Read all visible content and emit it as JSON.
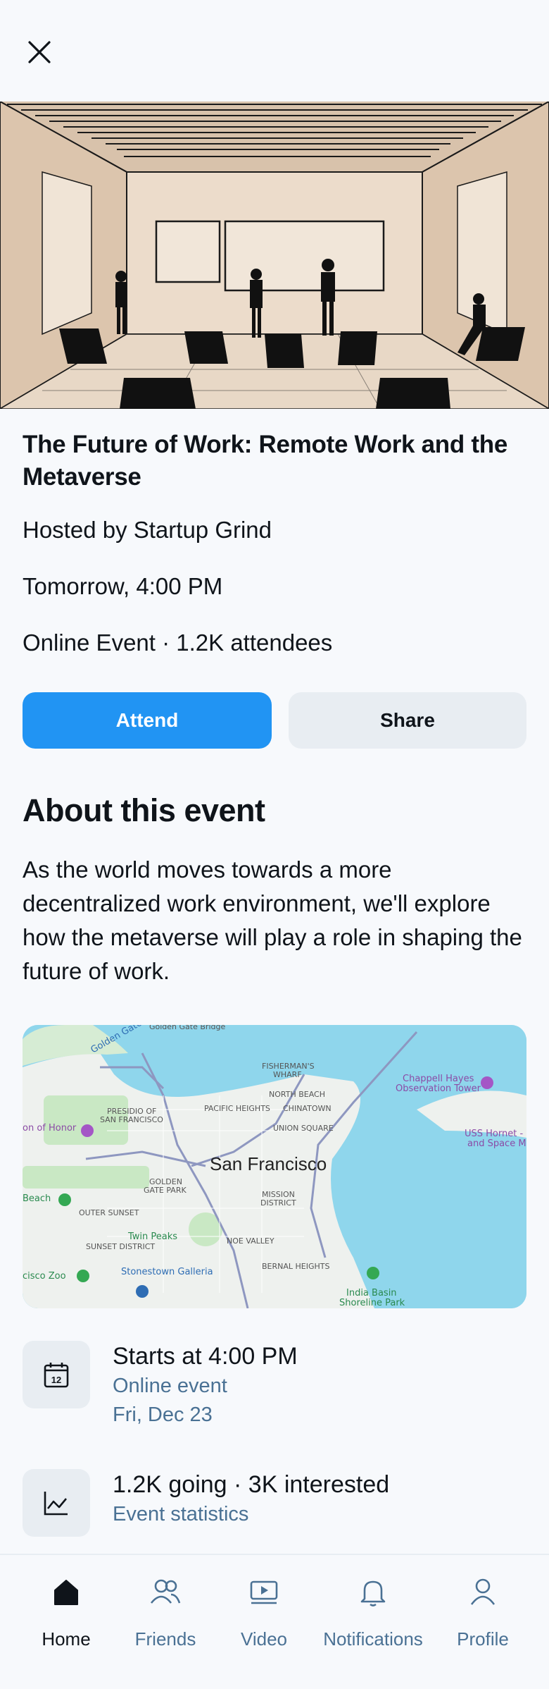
{
  "event": {
    "title": "The Future of Work: Remote Work and the Metaverse",
    "host": "Hosted by Startup Grind",
    "datetime": "Tomorrow, 4:00 PM",
    "location_attendance": "Online Event · 1.2K attendees"
  },
  "actions": {
    "attend_label": "Attend",
    "share_label": "Share"
  },
  "about": {
    "heading": "About this event",
    "description": "As the world moves towards a more decentralized work environment, we'll explore how the metaverse will play a role in shaping the future of work."
  },
  "map": {
    "city_label": "San Francisco",
    "places": [
      "Golden Gate Bridge",
      "FISHERMAN'S WHARF",
      "NORTH BEACH",
      "PACIFIC HEIGHTS",
      "CHINATOWN",
      "UNION SQUARE",
      "PRESIDIO OF SAN FRANCISCO",
      "GOLDEN GATE PARK",
      "MISSION DISTRICT",
      "OUTER SUNSET",
      "SUNSET DISTRICT",
      "Twin Peaks",
      "NOE VALLEY",
      "BERNAL HEIGHTS",
      "Stonestown Galleria",
      "Chappell Hayes Observation Tower",
      "USS Hornet - Sea and Space Museum",
      "India Basin Shoreline Park"
    ]
  },
  "details": [
    {
      "icon": "calendar-icon",
      "main": "Starts at 4:00 PM",
      "sub1": "Online event",
      "sub2": "Fri, Dec 23"
    },
    {
      "icon": "chart-icon",
      "main": "1.2K going · 3K interested",
      "sub1": "Event statistics"
    }
  ],
  "nav": [
    {
      "label": "Home",
      "icon": "home-icon",
      "active": true
    },
    {
      "label": "Friends",
      "icon": "friends-icon"
    },
    {
      "label": "Video",
      "icon": "video-icon"
    },
    {
      "label": "Notifications",
      "icon": "bell-icon"
    },
    {
      "label": "Profile",
      "icon": "profile-icon"
    }
  ],
  "colors": {
    "accent": "#2194f3",
    "muted_text": "#4a7194",
    "surface": "#e8edf2",
    "background": "#f7f9fc"
  }
}
